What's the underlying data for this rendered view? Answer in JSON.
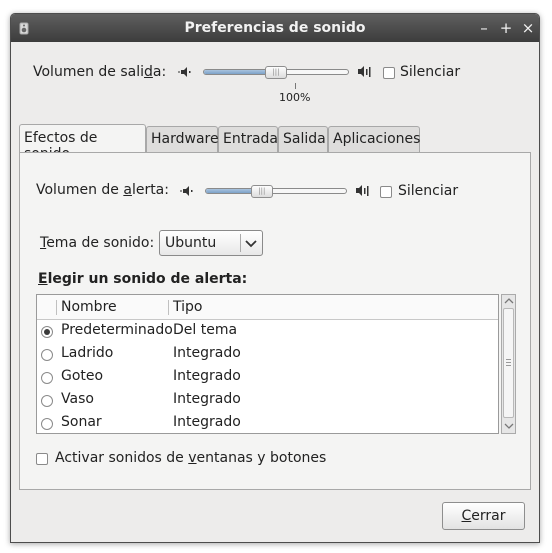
{
  "window": {
    "title": "Preferencias de sonido",
    "controls": {
      "minimize": "–",
      "maximize": "+",
      "close": "×"
    }
  },
  "output": {
    "label_pre": "Volumen de sali",
    "label_mnemonic": "d",
    "label_post": "a:",
    "level_percent": 50,
    "value_text": "100%",
    "mute_label": "Silenciar",
    "muted": false
  },
  "tabs": [
    {
      "label": "Efectos de sonido",
      "active": true
    },
    {
      "label": "Hardware",
      "active": false
    },
    {
      "label": "Entrada",
      "active": false
    },
    {
      "label": "Salida",
      "active": false
    },
    {
      "label": "Aplicaciones",
      "active": false
    }
  ],
  "effects": {
    "alert_volume": {
      "label_pre": "Volumen de ",
      "label_mnemonic": "a",
      "label_post": "lerta:",
      "level_percent": 40,
      "mute_label": "Silenciar",
      "muted": false
    },
    "theme": {
      "label_mnemonic": "T",
      "label_post": "ema de sonido:",
      "selected": "Ubuntu"
    },
    "alert_heading": {
      "mnemonic": "E",
      "rest": "legir un sonido de alerta:"
    },
    "columns": [
      "Nombre",
      "Tipo"
    ],
    "sounds": [
      {
        "name": "Predeterminado",
        "type": "Del tema",
        "selected": true
      },
      {
        "name": "Ladrido",
        "type": "Integrado",
        "selected": false
      },
      {
        "name": "Goteo",
        "type": "Integrado",
        "selected": false
      },
      {
        "name": "Vaso",
        "type": "Integrado",
        "selected": false
      },
      {
        "name": "Sonar",
        "type": "Integrado",
        "selected": false
      }
    ],
    "window_sounds": {
      "label_pre": "Activar sonidos de ",
      "label_mnemonic": "v",
      "label_post": "entanas y botones",
      "checked": false
    }
  },
  "close_button": {
    "mnemonic": "C",
    "rest": "errar"
  },
  "icons": {
    "app": "speaker-app-icon",
    "volume_low": "volume-low-icon",
    "volume_high": "volume-high-icon",
    "combo_arrow": "chevron-down-icon",
    "scroll_up": "scroll-up-arrow-icon",
    "scroll_down": "scroll-down-arrow-icon"
  },
  "colors": {
    "titlebar": "#4a4a4a",
    "window_bg": "#edeceb",
    "slider_fill": "#7da2c8"
  }
}
